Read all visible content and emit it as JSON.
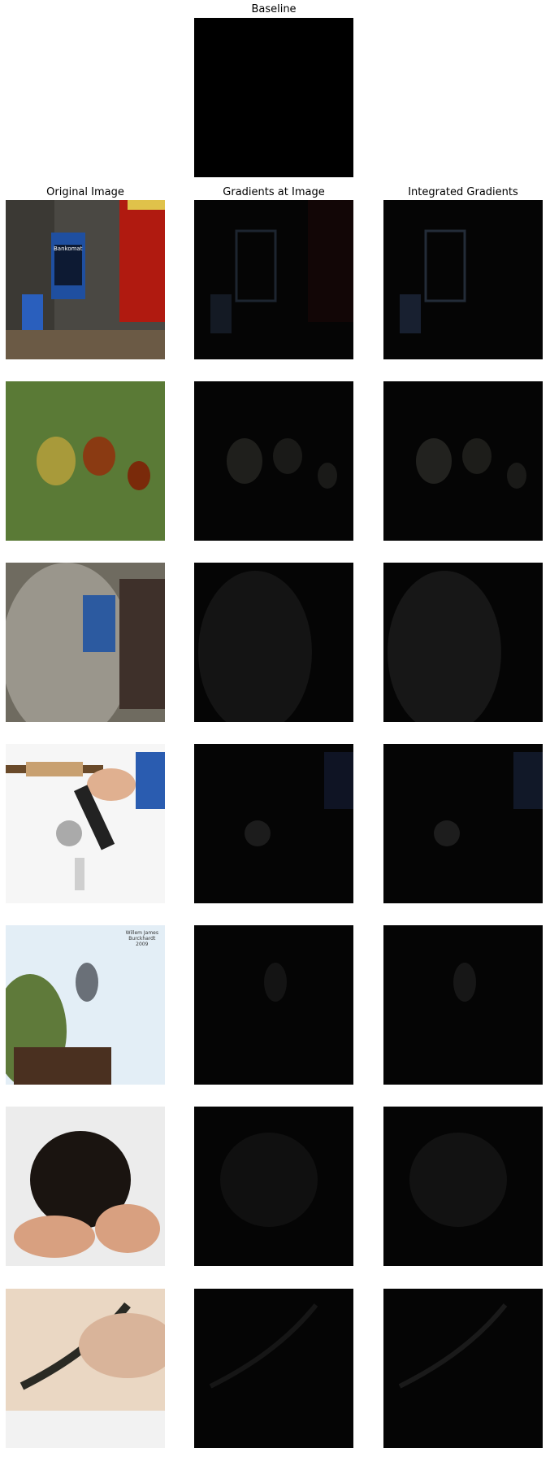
{
  "baseline": {
    "title": "Baseline"
  },
  "columns": {
    "original": "Original Image",
    "gradients": "Gradients at Image",
    "integrated": "Integrated Gradients"
  },
  "rows": [
    {
      "subject": "atm"
    },
    {
      "subject": "chestnuts"
    },
    {
      "subject": "steel-drum"
    },
    {
      "subject": "fishing-reel"
    },
    {
      "subject": "bird"
    },
    {
      "subject": "rottweiler-puppy"
    },
    {
      "subject": "snake"
    }
  ],
  "image_overlays": {
    "atm_sign": "Bankomat",
    "bird_watermark": "Willem James\nBurckhardt\n2009"
  }
}
